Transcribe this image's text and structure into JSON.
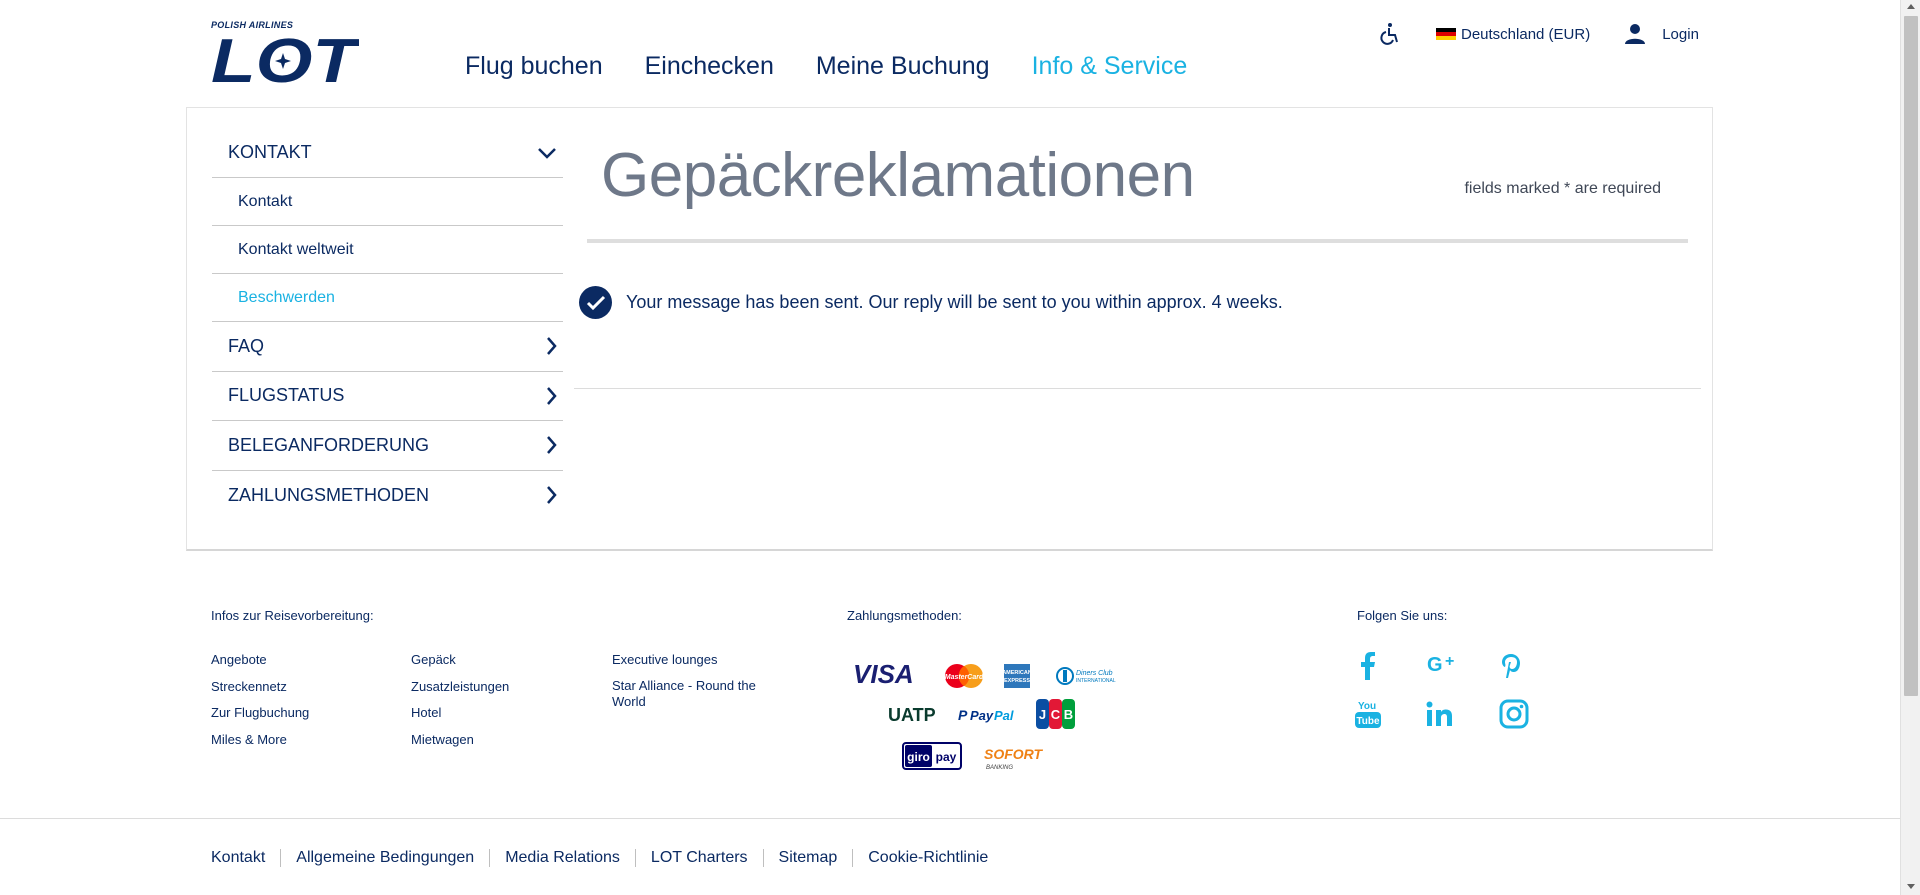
{
  "header": {
    "logo_tag": "POLISH AIRLINES",
    "logo_text": "LOT",
    "nav": [
      {
        "label": "Flug buchen",
        "active": false
      },
      {
        "label": "Einchecken",
        "active": false
      },
      {
        "label": "Meine Buchung",
        "active": false
      },
      {
        "label": "Info & Service",
        "active": true
      }
    ],
    "accessibility_icon": "wheelchair-icon",
    "language_label": "Deutschland (EUR)",
    "login_label": "Login"
  },
  "sidebar": {
    "sections": [
      {
        "label": "KONTAKT",
        "expanded": true,
        "items": [
          {
            "label": "Kontakt",
            "active": false
          },
          {
            "label": "Kontakt weltweit",
            "active": false
          },
          {
            "label": "Beschwerden",
            "active": true
          }
        ]
      },
      {
        "label": "FAQ",
        "expanded": false
      },
      {
        "label": "FLUGSTATUS",
        "expanded": false
      },
      {
        "label": "BELEGANFORDERUNG",
        "expanded": false
      },
      {
        "label": "ZAHLUNGSMETHODEN",
        "expanded": false
      }
    ]
  },
  "main": {
    "title": "Gepäckreklamationen",
    "required_note": "fields marked * are required",
    "success_message": "Your message has been sent. Our reply will be sent to you within approx. 4 weeks."
  },
  "footer": {
    "travel_info_title": "Infos zur Reisevorbereitung:",
    "travel_links_col1": [
      "Angebote",
      "Streckennetz",
      "Zur Flugbuchung",
      "Miles & More"
    ],
    "travel_links_col2": [
      "Gepäck",
      "Zusatzleistungen",
      "Hotel",
      "Mietwagen"
    ],
    "travel_links_col3": [
      "Executive lounges",
      "Star Alliance - Round the World"
    ],
    "payment_title": "Zahlungsmethoden:",
    "payment_logos": [
      "VISA",
      "MasterCard",
      "AMERICAN EXPRESS",
      "Diners Club INTERNATIONAL",
      "UATP",
      "PayPal",
      "JCB",
      "giropay",
      "SOFORT BANKING"
    ],
    "social_title": "Folgen Sie uns:",
    "social_icons": [
      "facebook-icon",
      "google-plus-icon",
      "pinterest-icon",
      "youtube-icon",
      "linkedin-icon",
      "instagram-icon"
    ],
    "bottom_links": [
      "Kontakt",
      "Allgemeine Bedingungen",
      "Media Relations",
      "LOT Charters",
      "Sitemap",
      "Cookie-Richtlinie"
    ]
  },
  "colors": {
    "navy": "#0b2a62",
    "accent": "#1ab2e2",
    "title_gray": "#6e7889"
  }
}
